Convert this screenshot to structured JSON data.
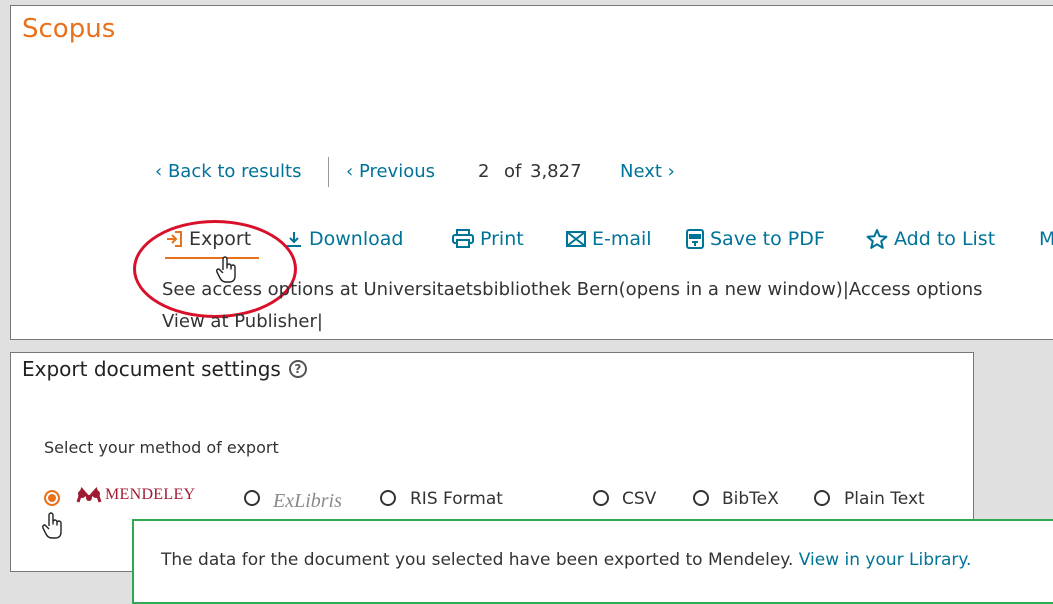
{
  "brand": "Scopus",
  "nav": {
    "back": "Back to results",
    "previous": "Previous",
    "current": "2",
    "of": "of",
    "total": "3,827",
    "next": "Next"
  },
  "toolbar": {
    "export": "Export",
    "download": "Download",
    "print": "Print",
    "email": "E-mail",
    "save_pdf": "Save to PDF",
    "add_list": "Add to List",
    "more": "M"
  },
  "access": {
    "line": "See access options at Universitaetsbibliothek Bern(opens in a new window)|Access options",
    "publisher": "View at Publisher|"
  },
  "export_settings": {
    "title": "Export document settings",
    "help": "?",
    "method_label": "Select your method of export",
    "options": {
      "mendeley": "MENDELEY",
      "exlibris": "ExLibris",
      "ris": "RIS Format",
      "csv": "CSV",
      "bibtex": "BibTeX",
      "plain": "Plain Text"
    },
    "selected": "mendeley"
  },
  "notice": {
    "text": "The data for the document you selected have been exported to Mendeley.",
    "link": "View in your Library."
  },
  "colors": {
    "brand": "#e9711c",
    "link": "#007398",
    "highlight": "#d8102a",
    "success_border": "#2fa84f",
    "mendeley": "#9e1b32"
  }
}
